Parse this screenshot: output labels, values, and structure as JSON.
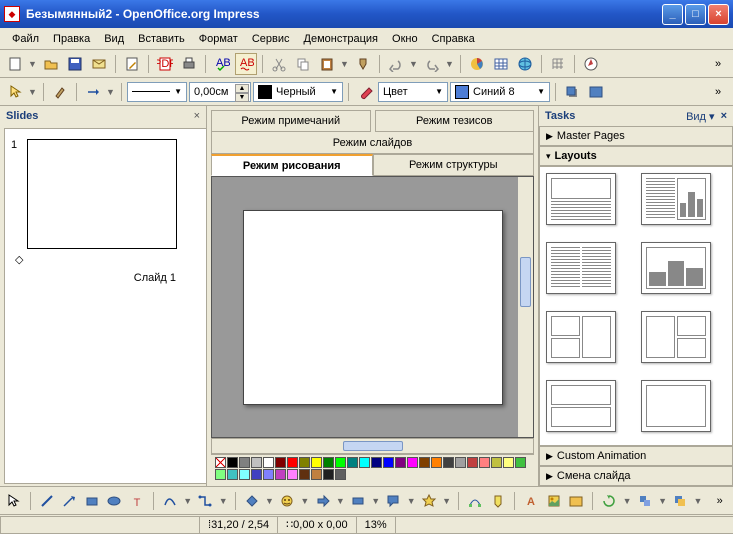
{
  "window": {
    "title": "Безымянный2 - OpenOffice.org Impress"
  },
  "menu": [
    "Файл",
    "Правка",
    "Вид",
    "Вставить",
    "Формат",
    "Сервис",
    "Демонстрация",
    "Окно",
    "Справка"
  ],
  "format_toolbar": {
    "line_width": "0,00см",
    "line_color_label": "Черный",
    "fill_type": "Цвет",
    "fill_color_label": "Синий 8"
  },
  "slides_pane": {
    "title": "Slides",
    "slide_number": "1",
    "slide_caption": "Слайд 1"
  },
  "view_tabs": {
    "notes": "Режим примечаний",
    "handout": "Режим тезисов",
    "normal": "Режим слайдов",
    "drawing": "Режим рисования",
    "outline": "Режим структуры"
  },
  "tasks": {
    "title": "Tasks",
    "view": "Вид",
    "master": "Master Pages",
    "layouts": "Layouts",
    "custom_anim": "Custom Animation",
    "slide_trans": "Смена слайда"
  },
  "status": {
    "pos": "31,20 / 2,54",
    "size": "0,00 x 0,00",
    "zoom": "13%"
  },
  "palette": [
    "#000000",
    "#808080",
    "#c0c0c0",
    "#ffffff",
    "#800000",
    "#ff0000",
    "#808000",
    "#ffff00",
    "#008000",
    "#00ff00",
    "#008080",
    "#00ffff",
    "#000080",
    "#0000ff",
    "#800080",
    "#ff00ff",
    "#804000",
    "#ff8000",
    "#404040",
    "#a0a0a0",
    "#c04040",
    "#ff8080",
    "#c0c040",
    "#ffff80",
    "#40c040",
    "#80ff80",
    "#40c0c0",
    "#80ffff",
    "#4040c0",
    "#8080ff",
    "#c040c0",
    "#ff80ff",
    "#603010",
    "#c08040",
    "#202020",
    "#606060"
  ]
}
